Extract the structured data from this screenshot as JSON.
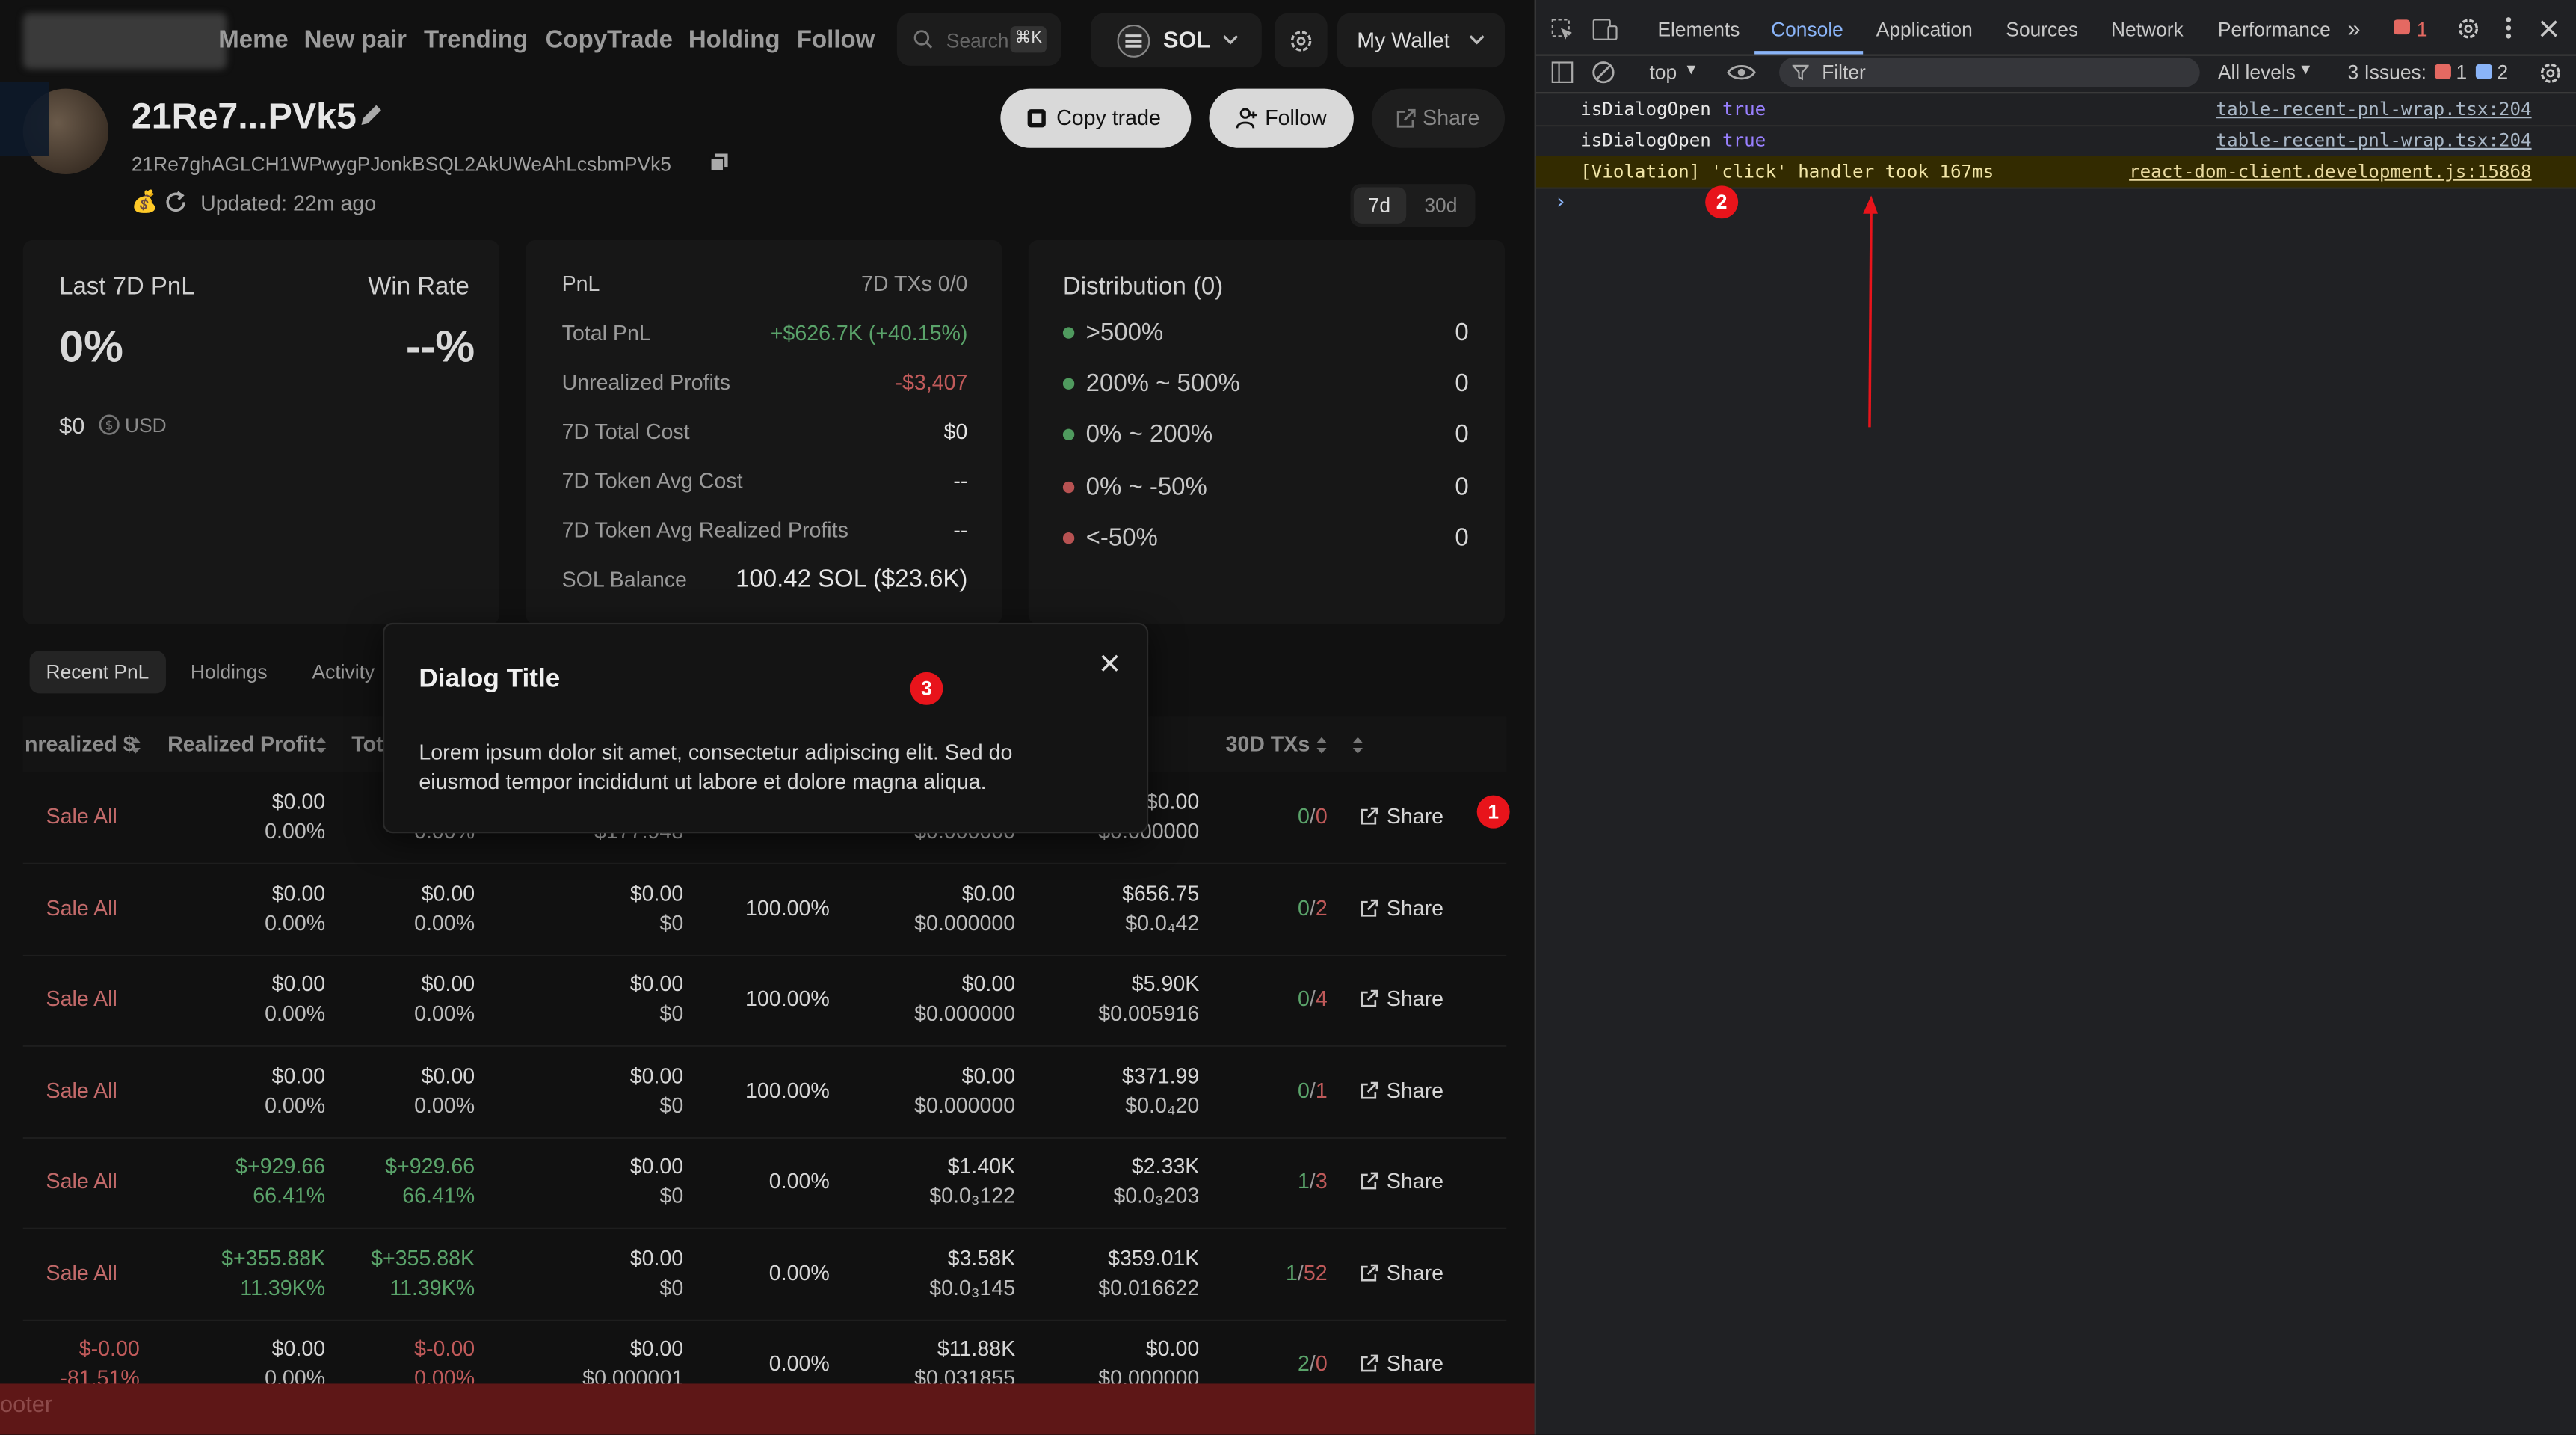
{
  "nav": {
    "links": [
      "Meme",
      "New pair",
      "Trending",
      "CopyTrade",
      "Holding",
      "Follow"
    ],
    "search_placeholder": "Search",
    "search_shortcut": "⌘K",
    "chain": "SOL",
    "wallet_button": "My Wallet"
  },
  "profile": {
    "name": "21Re7...PVk5",
    "address": "21Re7ghAGLCH1WPwygPJonkBSQL2AkUWeAhLcsbmPVk5",
    "updated": "Updated: 22m ago",
    "copy_trade": "Copy trade",
    "follow": "Follow",
    "share": "Share",
    "range_options": [
      "7d",
      "30d"
    ],
    "range_selected": "7d"
  },
  "summary": {
    "title_left": "Last 7D PnL",
    "title_right": "Win Rate",
    "pnl_percent": "0%",
    "win_rate": "--%",
    "usd_value": "$0",
    "usd_label": "USD"
  },
  "pnl_card": {
    "header": "PnL",
    "header_right": "7D TXs 0/0",
    "rows": [
      {
        "label": "Total PnL",
        "value": "+$626.7K (+40.15%)",
        "tone": "green"
      },
      {
        "label": "Unrealized Profits",
        "value": "-$3,407",
        "tone": "red"
      },
      {
        "label": "7D Total Cost",
        "value": "$0",
        "tone": "plain"
      },
      {
        "label": "7D Token Avg Cost",
        "value": "--",
        "tone": "plain"
      },
      {
        "label": "7D Token Avg Realized Profits",
        "value": "--",
        "tone": "plain"
      },
      {
        "label": "SOL Balance",
        "value": "100.42 SOL ($23.6K)",
        "tone": "big"
      }
    ]
  },
  "distribution": {
    "title": "Distribution (0)",
    "rows": [
      {
        "label": ">500%",
        "value": "0",
        "color": "#4f9a5e"
      },
      {
        "label": "200% ~ 500%",
        "value": "0",
        "color": "#4f9a5e"
      },
      {
        "label": "0% ~ 200%",
        "value": "0",
        "color": "#4f9a5e"
      },
      {
        "label": "0% ~ -50%",
        "value": "0",
        "color": "#b75252"
      },
      {
        "label": "<-50%",
        "value": "0",
        "color": "#b75252"
      }
    ]
  },
  "tabs": [
    "Recent PnL",
    "Holdings",
    "Activity"
  ],
  "table": {
    "headers": {
      "unrealized": "nrealized $",
      "realized": "Realized Profit",
      "total": "Tot",
      "txs": "30D TXs"
    },
    "sale_label": "Sale All",
    "share_label": "Share",
    "rows": [
      {
        "c1a": "$0.00",
        "c1b": "0.00%",
        "c2a": "",
        "c2b": "0.00%",
        "c3a": "",
        "c3b": "$177.948",
        "c4": "",
        "c5a": "",
        "c5b": "$0.000000",
        "c6a": "$0.00",
        "c6b": "$0.000000",
        "tx_a": "0",
        "tx_b": "0"
      },
      {
        "c1a": "$0.00",
        "c1b": "0.00%",
        "c2a": "$0.00",
        "c2b": "0.00%",
        "c3a": "$0.00",
        "c3b": "$0",
        "c4": "100.00%",
        "c5a": "$0.00",
        "c5b": "$0.000000",
        "c6a": "$656.75",
        "c6b": "$0.0₄42",
        "tx_a": "0",
        "tx_b": "2"
      },
      {
        "c1a": "$0.00",
        "c1b": "0.00%",
        "c2a": "$0.00",
        "c2b": "0.00%",
        "c3a": "$0.00",
        "c3b": "$0",
        "c4": "100.00%",
        "c5a": "$0.00",
        "c5b": "$0.000000",
        "c6a": "$5.90K",
        "c6b": "$0.005916",
        "tx_a": "0",
        "tx_b": "4"
      },
      {
        "c1a": "$0.00",
        "c1b": "0.00%",
        "c2a": "$0.00",
        "c2b": "0.00%",
        "c3a": "$0.00",
        "c3b": "$0",
        "c4": "100.00%",
        "c5a": "$0.00",
        "c5b": "$0.000000",
        "c6a": "$371.99",
        "c6b": "$0.0₄20",
        "tx_a": "0",
        "tx_b": "1"
      },
      {
        "c1a": "$+929.66",
        "c1b": "66.41%",
        "c2a": "$+929.66",
        "c2b": "66.41%",
        "c3a": "$0.00",
        "c3b": "$0",
        "c4": "0.00%",
        "c5a": "$1.40K",
        "c5b": "$0.0₃122",
        "c6a": "$2.33K",
        "c6b": "$0.0₃203",
        "tx_a": "1",
        "tx_b": "3",
        "tone": "green"
      },
      {
        "c1a": "$+355.88K",
        "c1b": "11.39K%",
        "c2a": "$+355.88K",
        "c2b": "11.39K%",
        "c3a": "$0.00",
        "c3b": "$0",
        "c4": "0.00%",
        "c5a": "$3.58K",
        "c5b": "$0.0₃145",
        "c6a": "$359.01K",
        "c6b": "$0.016622",
        "tx_a": "1",
        "tx_b": "52",
        "tone": "green"
      },
      {
        "sale_a": "$-0.00",
        "sale_b": "-81.51%",
        "c1a": "$0.00",
        "c1b": "0.00%",
        "c2a": "$-0.00",
        "c2b": "0.00%",
        "c3a": "$0.00",
        "c3b": "$0.000001",
        "c4": "0.00%",
        "c5a": "$11.88K",
        "c5b": "$0.031855",
        "c6a": "$0.00",
        "c6b": "$0.000000",
        "tx_a": "2",
        "tx_b": "0",
        "tone": "red"
      }
    ]
  },
  "footer_text": "ooter",
  "dialog": {
    "title": "Dialog Title",
    "body": "Lorem ipsum dolor sit amet, consectetur adipiscing elit. Sed do eiusmod tempor incididunt ut labore et dolore magna aliqua."
  },
  "annotations": [
    "1",
    "2",
    "3"
  ],
  "devtools": {
    "tabs": [
      "Elements",
      "Console",
      "Application",
      "Sources",
      "Network",
      "Performance"
    ],
    "active_tab": "Console",
    "error_count": "1",
    "context": "top",
    "filter_placeholder": "Filter",
    "levels": "All levels",
    "issues_label": "3 Issues:",
    "issues_err": "1",
    "issues_info": "2",
    "logs": [
      {
        "text": "isDialogOpen",
        "value": "true",
        "source": "table-recent-pnl-wrap.tsx:204",
        "type": "log"
      },
      {
        "text": "isDialogOpen",
        "value": "true",
        "source": "table-recent-pnl-wrap.tsx:204",
        "type": "log"
      },
      {
        "text": "[Violation] 'click' handler took 167ms",
        "value": "",
        "source": "react-dom-client.development.js:15868",
        "type": "warn"
      }
    ],
    "prompt": "›"
  },
  "colors": {
    "accent_green": "#5aa36a",
    "accent_red": "#c05a5a",
    "badge": "#e8141b",
    "warn_bg": "#332b00"
  }
}
